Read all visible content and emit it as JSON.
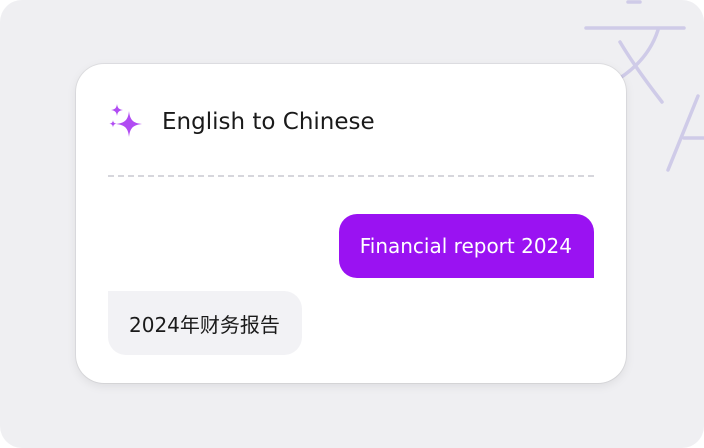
{
  "header": {
    "title": "English to Chinese",
    "icon": "sparkle-icon"
  },
  "messages": [
    {
      "role": "user",
      "text": "Financial report 2024"
    },
    {
      "role": "assistant",
      "text": "2024年财务报告"
    }
  ],
  "colors": {
    "accent": "#9a12f2",
    "icon": "#b14cf3",
    "background": "#efeff2",
    "reply_bubble": "#f2f2f5"
  },
  "background_icon": "translate-icon"
}
